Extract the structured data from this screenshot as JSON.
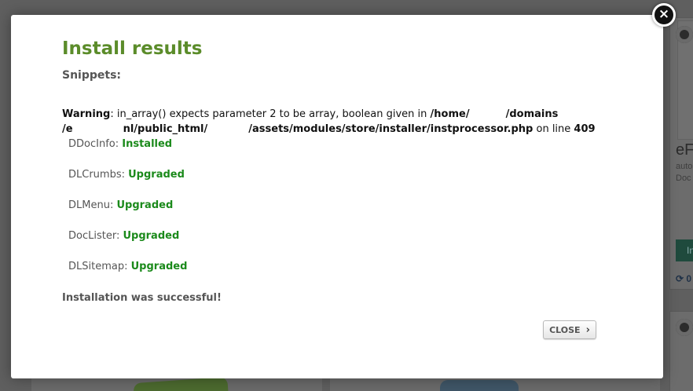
{
  "background": {
    "card_title": "eF",
    "card_line1": "auto",
    "card_line2": "Doc",
    "card_button": "In",
    "card_stat": "0"
  },
  "modal": {
    "title": "Install results",
    "section_label": "Snippets:",
    "warning": {
      "label": "Warning",
      "message": ": in_array() expects parameter 2 to be array, boolean given in ",
      "path_part1": "/home/",
      "path_part2": "/domains",
      "path_part3": "/e",
      "path_part4": "nl/public_html/",
      "path_part5": "/assets/modules/store/installer/instprocessor.php",
      "line_text": " on line ",
      "line_number": "409"
    },
    "results": [
      {
        "name": "DDocInfo",
        "status": "Installed"
      },
      {
        "name": "DLCrumbs",
        "status": "Upgraded"
      },
      {
        "name": "DLMenu",
        "status": "Upgraded"
      },
      {
        "name": "DocLister",
        "status": "Upgraded"
      },
      {
        "name": "DLSitemap",
        "status": "Upgraded"
      }
    ],
    "success_message": "Installation was successful!",
    "close_button_label": "CLOSE",
    "close_button_icon": "chevron-right-icon",
    "close_x_icon": "close-icon"
  },
  "colors": {
    "title_green": "#5b8c2a",
    "status_green": "#1b8a1b",
    "overlay": "#5f5f5f"
  }
}
